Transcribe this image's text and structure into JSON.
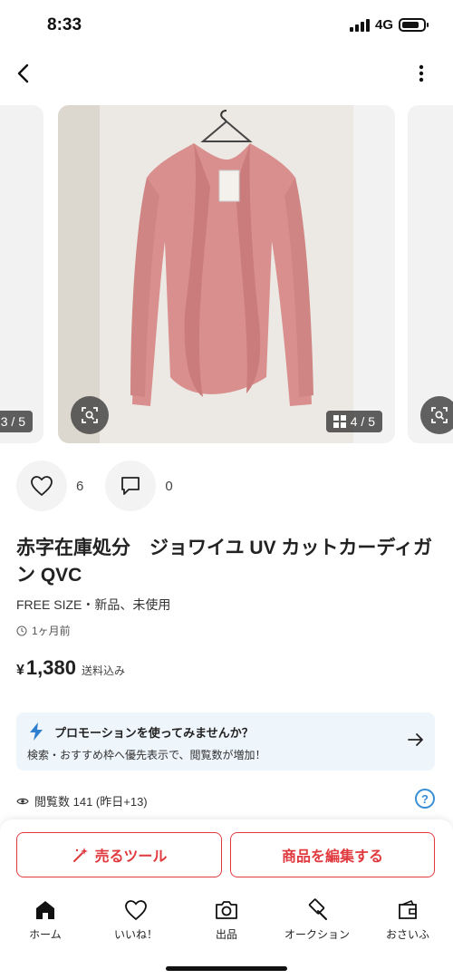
{
  "status_bar": {
    "time": "8:33",
    "network": "4G"
  },
  "carousel": {
    "prev_counter": "3 / 5",
    "main_counter": "4 / 5"
  },
  "social": {
    "likes": "6",
    "comments": "0"
  },
  "item": {
    "title": "赤字在庫処分　ジョワイユ UV カットカーディガン QVC",
    "condition": "FREE SIZE・新品、未使用",
    "posted": "1ヶ月前",
    "price_symbol": "¥",
    "price": "1,380",
    "shipping": "送料込み"
  },
  "promo": {
    "title": "プロモーションを使ってみませんか？",
    "description": "検索・おすすめ枠へ優先表示で、閲覧数が増加！"
  },
  "stats": {
    "views": "閲覧数  141 (昨日+13)"
  },
  "actions": {
    "sell_tool": "売るツール",
    "edit_item": "商品を編集する"
  },
  "tabs": [
    {
      "label": "ホーム",
      "icon": "home-icon"
    },
    {
      "label": "いいね！",
      "icon": "heart-icon"
    },
    {
      "label": "出品",
      "icon": "camera-icon"
    },
    {
      "label": "オークション",
      "icon": "gavel-icon"
    },
    {
      "label": "おさいふ",
      "icon": "wallet-icon"
    }
  ],
  "colors": {
    "accent": "#e0393e",
    "promo_bg": "#eef5fb",
    "lightning": "#2f7fd0",
    "cardigan": "#d98f8d"
  }
}
